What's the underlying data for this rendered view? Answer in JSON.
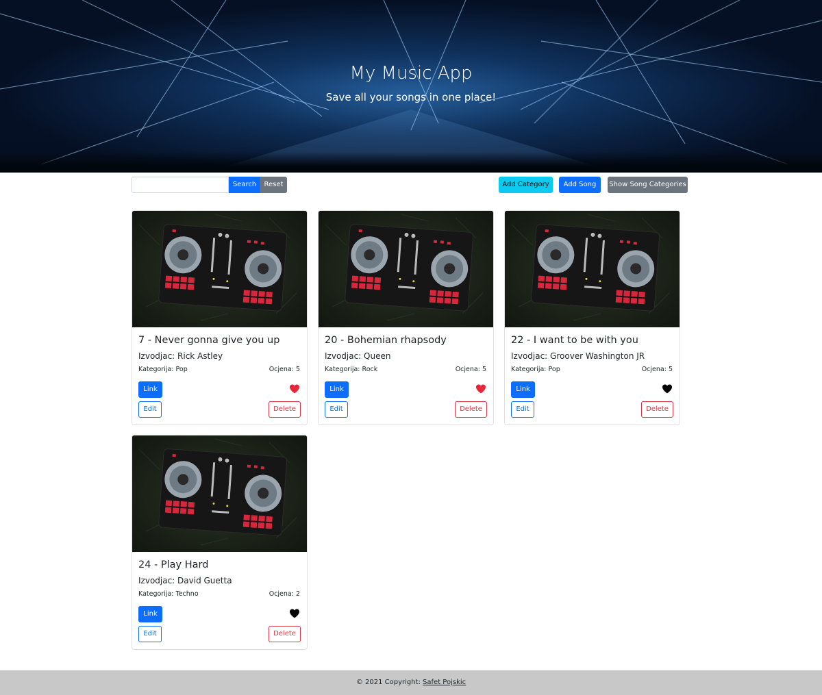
{
  "hero": {
    "title": "My Music App",
    "subtitle": "Save all your songs in one place!"
  },
  "toolbar": {
    "search_value": "",
    "search_placeholder": "",
    "search_label": "Search",
    "reset_label": "Reset",
    "add_category_label": "Add Category",
    "add_song_label": "Add Song",
    "show_categories_label": "Show Song Categories"
  },
  "songs": [
    {
      "title": "7 - Never gonna give you up",
      "artist": "Izvodjac: Rick Astley",
      "category": "Kategorija: Pop",
      "rating": "Ocjena: 5",
      "favorite": true,
      "link_label": "Link",
      "edit_label": "Edit",
      "delete_label": "Delete"
    },
    {
      "title": "20 - Bohemian rhapsody",
      "artist": "Izvodjac: Queen",
      "category": "Kategorija: Rock",
      "rating": "Ocjena: 5",
      "favorite": true,
      "link_label": "Link",
      "edit_label": "Edit",
      "delete_label": "Delete"
    },
    {
      "title": "22 - I want to be with you",
      "artist": "Izvodjac: Groover Washington JR",
      "category": "Kategorija: Pop",
      "rating": "Ocjena: 5",
      "favorite": false,
      "link_label": "Link",
      "edit_label": "Edit",
      "delete_label": "Delete"
    },
    {
      "title": "24 - Play Hard",
      "artist": "Izvodjac: David Guetta",
      "category": "Kategorija: Techno",
      "rating": "Ocjena: 2",
      "favorite": false,
      "link_label": "Link",
      "edit_label": "Edit",
      "delete_label": "Delete"
    }
  ],
  "colors": {
    "favorite_on": "#e8283a",
    "favorite_off": "#000000",
    "primary": "#0d6efd",
    "danger": "#dc3545",
    "info": "#0dcaf0",
    "secondary": "#6c757d"
  },
  "footer": {
    "text": "© 2021 Copyright: ",
    "author_link": "Safet Pojskic"
  }
}
